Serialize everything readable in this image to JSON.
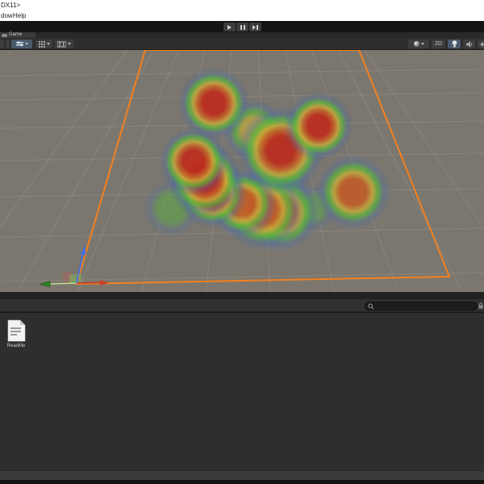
{
  "window": {
    "title": "DX11>",
    "menu": [
      "dow",
      "Help"
    ]
  },
  "playbar": {
    "icons": [
      "play-icon",
      "pause-icon",
      "step-icon"
    ]
  },
  "game_view": {
    "tab_label": "Game",
    "toolbar": {
      "mode_2d_label": "2D",
      "icons": [
        "scene-filter-icon",
        "grid-snap-icon",
        "camera-view-icon",
        "render-mode-sphere-icon",
        "lighting-bulb-icon",
        "audio-speaker-icon",
        "effects-icon"
      ]
    }
  },
  "scene": {
    "ground_color": "#7b776e",
    "grid_color": "rgba(218,212,196,0.16)",
    "selection_color": "#f5801e",
    "gizmo": {
      "x_color": "#c4402a",
      "y_color": "#4271e0",
      "z_color": "#2e8a22"
    },
    "heatmap": {
      "palettes": {
        "red": [
          [
            "rgba(188,44,30,0.93)",
            0
          ],
          [
            "rgba(188,44,30,0.93)",
            30
          ],
          [
            "rgba(196,98,40,0.90)",
            44
          ],
          [
            "rgba(198,168,58,0.85)",
            55
          ],
          [
            "rgba(88,178,62,0.78)",
            67
          ],
          [
            "rgba(80,110,160,0.42)",
            80
          ],
          [
            "rgba(80,100,150,0.18)",
            90
          ],
          [
            "rgba(80,100,150,0)",
            100
          ]
        ],
        "orange": [
          [
            "rgba(192,92,40,0.90)",
            0
          ],
          [
            "rgba(192,92,40,0.90)",
            34
          ],
          [
            "rgba(198,168,58,0.85)",
            50
          ],
          [
            "rgba(88,178,62,0.78)",
            64
          ],
          [
            "rgba(80,110,160,0.40)",
            79
          ],
          [
            "rgba(80,100,150,0)",
            100
          ]
        ],
        "yellow": [
          [
            "rgba(196,170,60,0.82)",
            0
          ],
          [
            "rgba(196,170,60,0.80)",
            38
          ],
          [
            "rgba(88,178,62,0.72)",
            58
          ],
          [
            "rgba(80,110,160,0.35)",
            78
          ],
          [
            "rgba(80,100,150,0)",
            100
          ]
        ],
        "green": [
          [
            "rgba(88,172,66,0.55)",
            0
          ],
          [
            "rgba(88,172,66,0.50)",
            45
          ],
          [
            "rgba(80,110,160,0.30)",
            72
          ],
          [
            "rgba(80,100,150,0)",
            100
          ]
        ]
      },
      "blobs": [
        [
          265,
          66,
          46,
          "red"
        ],
        [
          395,
          94,
          44,
          "red"
        ],
        [
          348,
          124,
          56,
          "red"
        ],
        [
          240,
          138,
          44,
          "red"
        ],
        [
          254,
          160,
          48,
          "red"
        ],
        [
          263,
          178,
          44,
          "red"
        ],
        [
          300,
          190,
          44,
          "orange"
        ],
        [
          325,
          198,
          52,
          "orange"
        ],
        [
          348,
          201,
          50,
          "orange"
        ],
        [
          438,
          176,
          48,
          "orange"
        ],
        [
          315,
          100,
          40,
          "yellow"
        ],
        [
          332,
          106,
          28,
          "yellow"
        ],
        [
          213,
          196,
          38,
          "green"
        ],
        [
          352,
          162,
          32,
          "green"
        ],
        [
          388,
          196,
          30,
          "green"
        ]
      ]
    }
  },
  "project": {
    "search_placeholder": "",
    "assets": [
      {
        "name": "ReadMe"
      }
    ]
  }
}
